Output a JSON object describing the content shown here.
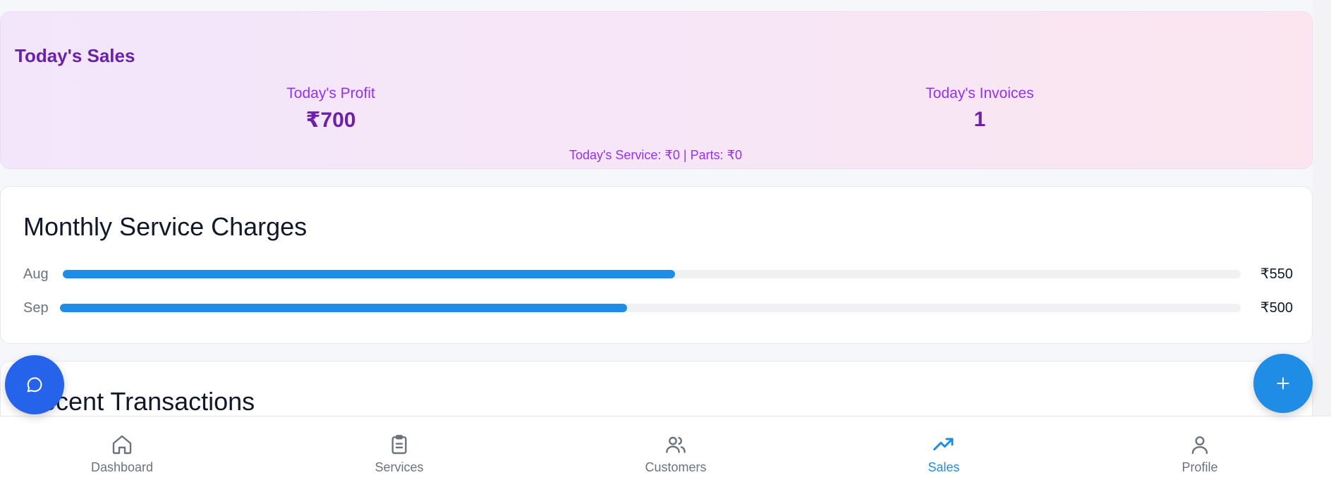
{
  "todays_sales": {
    "title": "Today's Sales",
    "profit_label": "Today's Profit",
    "profit_value": "₹700",
    "invoices_label": "Today's Invoices",
    "invoices_value": "1",
    "breakdown": "Today's Service: ₹0 | Parts: ₹0"
  },
  "monthly_charges": {
    "title": "Monthly Service Charges",
    "rows": [
      {
        "month": "Aug",
        "amount": "₹550",
        "fill_fraction": 0.52
      },
      {
        "month": "Sep",
        "amount": "₹500",
        "fill_fraction": 0.48
      }
    ]
  },
  "recent_transactions": {
    "title": "Recent Transactions"
  },
  "nav": {
    "items": [
      {
        "label": "Dashboard",
        "icon": "home-icon",
        "active": false
      },
      {
        "label": "Services",
        "icon": "clipboard-list-icon",
        "active": false
      },
      {
        "label": "Customers",
        "icon": "users-icon",
        "active": false
      },
      {
        "label": "Sales",
        "icon": "trending-up-icon",
        "active": true
      },
      {
        "label": "Profile",
        "icon": "user-icon",
        "active": false
      }
    ]
  },
  "fabs": {
    "chat_icon": "chat-bubble-icon",
    "add_icon": "plus-icon"
  },
  "colors": {
    "accent": "#1f8ce6",
    "sales_title": "#6b21a8",
    "sales_label": "#9333ea",
    "chat_fab": "#2563eb"
  }
}
